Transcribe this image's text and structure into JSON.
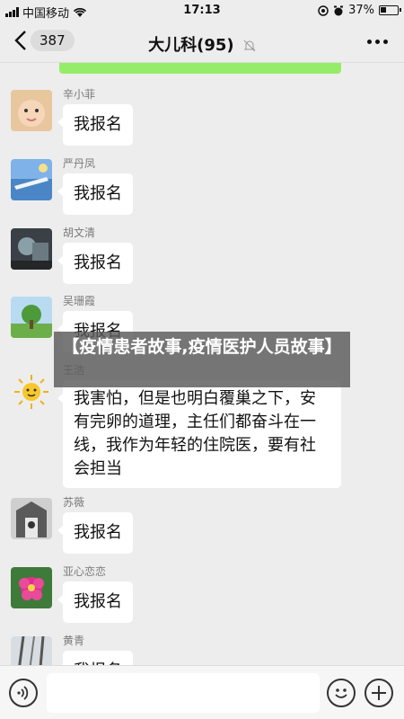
{
  "status_bar": {
    "carrier": "中国移动",
    "time": "17:13",
    "battery": "37%",
    "icons": [
      "signal-icon",
      "wifi-icon",
      "location-icon",
      "alarm-icon",
      "battery-icon"
    ]
  },
  "nav": {
    "unread_count": "387",
    "title": "大儿科(95)",
    "icons": [
      "back-chevron-icon",
      "mute-icon",
      "more-icon"
    ]
  },
  "messages": [
    {
      "sender": "辛小菲",
      "text": "我报名",
      "avatar": "baby-avatar"
    },
    {
      "sender": "严丹凤",
      "text": "我报名",
      "avatar": "blue-scene-avatar"
    },
    {
      "sender": "胡文清",
      "text": "我报名",
      "avatar": "dark-scene-avatar"
    },
    {
      "sender": "吴珊霞",
      "text": "我报名",
      "avatar": "tree-avatar"
    },
    {
      "sender": "王浩",
      "text": "我害怕，但是也明白覆巢之下，安有完卵的道理，主任们都奋斗在一线，我作为年轻的住院医，要有社会担当",
      "avatar": "sun-avatar"
    },
    {
      "sender": "苏薇",
      "text": "我报名",
      "avatar": "gate-avatar"
    },
    {
      "sender": "亚心恋恋",
      "text": "我报名",
      "avatar": "flower-avatar"
    },
    {
      "sender": "黄青",
      "text": "我报名",
      "avatar": "branch-avatar"
    }
  ],
  "overlay_caption": "【疫情患者故事,疫情医护人员故事】",
  "colors": {
    "self_bubble": "#95ec69",
    "background": "#ededed",
    "bubble": "#ffffff"
  }
}
